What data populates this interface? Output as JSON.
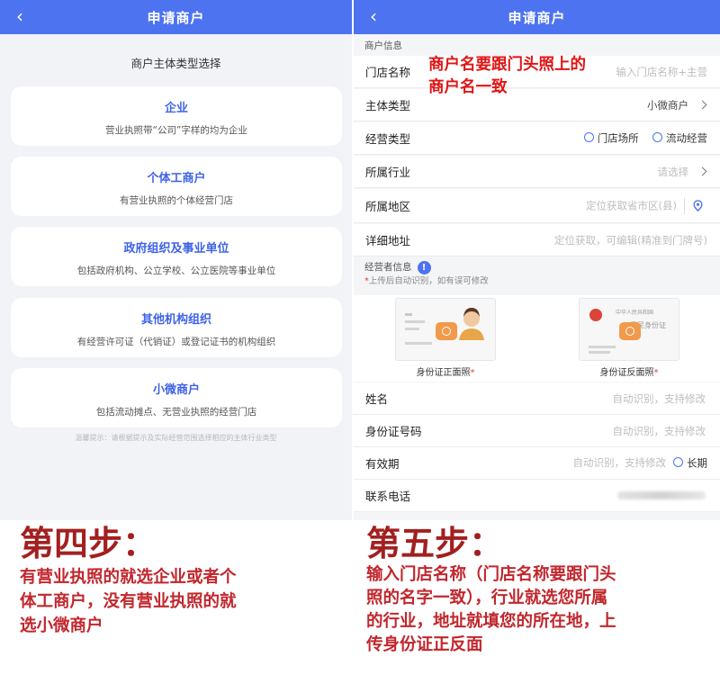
{
  "left_screen": {
    "nav_title": "申请商户",
    "back_icon": "chevron-left-icon",
    "section_title": "商户主体类型选择",
    "cards": [
      {
        "title": "企业",
        "desc": "营业执照带“公司”字样的均为企业"
      },
      {
        "title": "个体工商户",
        "desc": "有营业执照的个体经营门店"
      },
      {
        "title": "政府组织及事业单位",
        "desc": "包括政府机构、公立学校、公立医院等事业单位"
      },
      {
        "title": "其他机构组织",
        "desc": "有经营许可证（代销证）或登记证书的机构组织"
      },
      {
        "title": "小微商户",
        "desc": "包括流动摊点、无营业执照的经营门店"
      }
    ],
    "tip": "温馨提示：请根据提示及实际经营范围选择相应的主体行业类型"
  },
  "right_screen": {
    "nav_title": "申请商户",
    "merchant_info_label": "商户信息",
    "overlay_note": [
      "商户名要跟门头照上的",
      "商户名一致"
    ],
    "rows": {
      "store_name": {
        "label": "门店名称",
        "placeholder": "输入门店名称+主营"
      },
      "subject_type": {
        "label": "主体类型",
        "value": "小微商户"
      },
      "business_type": {
        "label": "经营类型",
        "option1": "门店场所",
        "option2": "流动经营"
      },
      "industry": {
        "label": "所属行业",
        "placeholder": "请选择"
      },
      "region": {
        "label": "所属地区",
        "placeholder": "定位获取省市区(县)"
      },
      "address": {
        "label": "详细地址",
        "placeholder": "定位获取，可编辑(精准到门牌号)"
      }
    },
    "operator_label": "经营者信息",
    "operator_hint_star": "*",
    "operator_hint": "上传后自动识别，如有误可修改",
    "id_front": {
      "caption": "身份证正面照",
      "star": "*"
    },
    "id_back": {
      "caption": "身份证反面照",
      "star": "*",
      "card_text": [
        "中华人民共和国",
        "居民身份证"
      ]
    },
    "person_rows": {
      "name": {
        "label": "姓名",
        "placeholder": "自动识别，支持修改"
      },
      "id_number": {
        "label": "身份证号码",
        "placeholder": "自动识别，支持修改"
      },
      "validity": {
        "label": "有效期",
        "placeholder": "自动识别，支持修改",
        "option": "长期"
      },
      "phone": {
        "label": "联系电话"
      }
    }
  },
  "captions": {
    "step4_title": "第四步：",
    "step4_lines": [
      "有营业执照的就选企业或者个",
      "体工商户，没有营业执照的就",
      "选小微商户"
    ],
    "step5_title": "第五步：",
    "step5_lines": [
      "输入门店名称（门店名称要跟门头",
      "照的名字一致），行业就选您所属",
      "的行业，地址就填您的所在地，上",
      "传身份证正反面"
    ]
  },
  "colors": {
    "nav": "#4d73f0",
    "card_title": "#3f63e6",
    "caption_red": "#c1272d",
    "note_red": "#e01414"
  }
}
